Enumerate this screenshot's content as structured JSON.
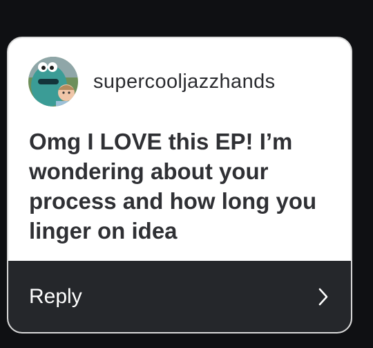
{
  "question_card": {
    "username": "supercooljazzhands",
    "avatar_icon": "profile-photo-avatar",
    "question_text": "Omg I LOVE this EP! I’m wondering about your process and how long you linger on idea",
    "reply_label": "Reply",
    "reply_icon": "chevron-right-icon"
  },
  "colors": {
    "background": "#0f1013",
    "card": "#ffffff",
    "text": "#2f3034",
    "reply_bar": "#25272b",
    "reply_text": "#ffffff"
  }
}
